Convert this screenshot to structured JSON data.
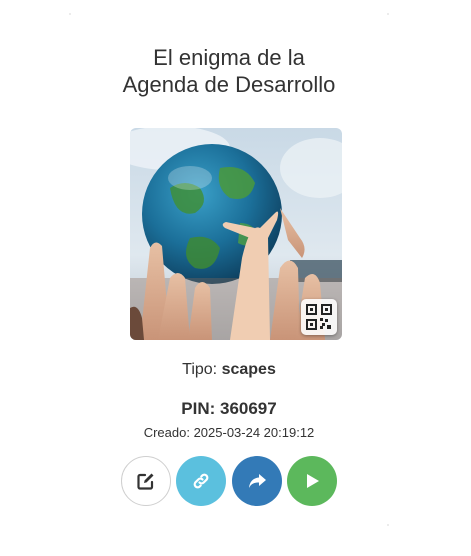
{
  "title": {
    "line1": "El enigma de la",
    "line2": "Agenda de Desarrollo"
  },
  "thumbnail": {
    "alt": "Manos sosteniendo un globo terráqueo",
    "qr_icon": "qr-code-icon"
  },
  "type": {
    "label": "Tipo:",
    "value": "scapes"
  },
  "pin": {
    "label": "PIN: 360697"
  },
  "created": {
    "label": "Creado: 2025-03-24 20:19:12"
  },
  "actions": [
    {
      "icon": "edit-icon",
      "color": "#ffffff"
    },
    {
      "icon": "link-icon",
      "color": "#5bc0de"
    },
    {
      "icon": "share-icon",
      "color": "#337ab7"
    },
    {
      "icon": "play-icon",
      "color": "#5cb85c"
    }
  ]
}
